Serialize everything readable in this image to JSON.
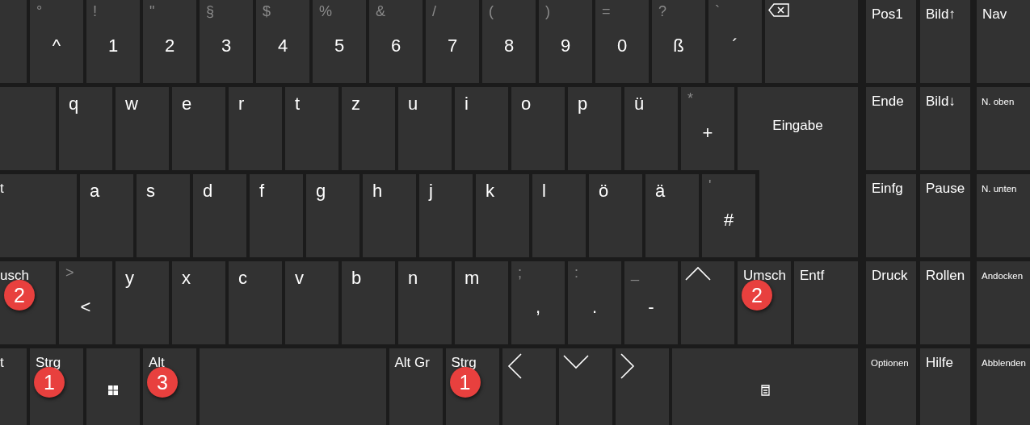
{
  "keyboard": {
    "rows": [
      {
        "keys": [
          {
            "kind": "partial"
          },
          {
            "kind": "dual",
            "shift": "°",
            "label": "^"
          },
          {
            "kind": "dual",
            "shift": "!",
            "label": "1"
          },
          {
            "kind": "dual",
            "shift": "\"",
            "label": "2"
          },
          {
            "kind": "dual",
            "shift": "§",
            "label": "3"
          },
          {
            "kind": "dual",
            "shift": "$",
            "label": "4"
          },
          {
            "kind": "dual",
            "shift": "%",
            "label": "5"
          },
          {
            "kind": "dual",
            "shift": "&",
            "label": "6"
          },
          {
            "kind": "dual",
            "shift": "/",
            "label": "7"
          },
          {
            "kind": "dual",
            "shift": "(",
            "label": "8"
          },
          {
            "kind": "dual",
            "shift": ")",
            "label": "9"
          },
          {
            "kind": "dual",
            "shift": "=",
            "label": "0"
          },
          {
            "kind": "dual",
            "shift": "?",
            "label": "ß"
          },
          {
            "kind": "dual",
            "shift": "`",
            "label": "´"
          },
          {
            "kind": "backspace"
          }
        ]
      },
      {
        "keys": [
          {
            "kind": "partial"
          },
          {
            "kind": "letter",
            "label": "q"
          },
          {
            "kind": "letter",
            "label": "w"
          },
          {
            "kind": "letter",
            "label": "e"
          },
          {
            "kind": "letter",
            "label": "r"
          },
          {
            "kind": "letter",
            "label": "t"
          },
          {
            "kind": "letter",
            "label": "z"
          },
          {
            "kind": "letter",
            "label": "u"
          },
          {
            "kind": "letter",
            "label": "i"
          },
          {
            "kind": "letter",
            "label": "o"
          },
          {
            "kind": "letter",
            "label": "p"
          },
          {
            "kind": "letter",
            "label": "ü"
          },
          {
            "kind": "dual",
            "shift": "*",
            "label": "+"
          },
          {
            "kind": "enter",
            "label": "Eingabe"
          }
        ]
      },
      {
        "keys": [
          {
            "kind": "partial",
            "label": "t"
          },
          {
            "kind": "letter",
            "label": "a"
          },
          {
            "kind": "letter",
            "label": "s"
          },
          {
            "kind": "letter",
            "label": "d"
          },
          {
            "kind": "letter",
            "label": "f"
          },
          {
            "kind": "letter",
            "label": "g"
          },
          {
            "kind": "letter",
            "label": "h"
          },
          {
            "kind": "letter",
            "label": "j"
          },
          {
            "kind": "letter",
            "label": "k"
          },
          {
            "kind": "letter",
            "label": "l"
          },
          {
            "kind": "letter",
            "label": "ö"
          },
          {
            "kind": "letter",
            "label": "ä"
          },
          {
            "kind": "dual",
            "shift": "'",
            "label": "#"
          }
        ]
      },
      {
        "keys": [
          {
            "kind": "partial",
            "label": "usch",
            "badge": "2"
          },
          {
            "kind": "dual",
            "shift": ">",
            "label": "<"
          },
          {
            "kind": "letter",
            "label": "y"
          },
          {
            "kind": "letter",
            "label": "x"
          },
          {
            "kind": "letter",
            "label": "c"
          },
          {
            "kind": "letter",
            "label": "v"
          },
          {
            "kind": "letter",
            "label": "b"
          },
          {
            "kind": "letter",
            "label": "n"
          },
          {
            "kind": "letter",
            "label": "m"
          },
          {
            "kind": "dual",
            "shift": ";",
            "label": ","
          },
          {
            "kind": "dual",
            "shift": ":",
            "label": "."
          },
          {
            "kind": "dual",
            "shift": "_",
            "label": "-"
          },
          {
            "kind": "arrow-up"
          },
          {
            "kind": "mod",
            "label": "Umsch",
            "badge": "2"
          },
          {
            "kind": "mod",
            "label": "Entf"
          }
        ]
      },
      {
        "keys": [
          {
            "kind": "partial",
            "label": "t"
          },
          {
            "kind": "mod",
            "label": "Strg",
            "badge": "1"
          },
          {
            "kind": "windows"
          },
          {
            "kind": "mod",
            "label": "Alt",
            "badge": "3"
          },
          {
            "kind": "space"
          },
          {
            "kind": "mod",
            "label": "Alt Gr"
          },
          {
            "kind": "mod",
            "label": "Strg",
            "badge": "1"
          },
          {
            "kind": "arrow-left"
          },
          {
            "kind": "arrow-down"
          },
          {
            "kind": "arrow-right"
          },
          {
            "kind": "menu"
          }
        ]
      }
    ]
  },
  "nav_keys": [
    {
      "kind": "mod",
      "label": "Pos1"
    },
    {
      "kind": "mod",
      "label": "Bild↑"
    },
    {
      "kind": "mod",
      "label": "Nav"
    },
    {
      "kind": "mod",
      "label": "Ende"
    },
    {
      "kind": "mod",
      "label": "Bild↓"
    },
    {
      "kind": "small",
      "label": "N. oben"
    },
    {
      "kind": "mod",
      "label": "Einfg"
    },
    {
      "kind": "mod",
      "label": "Pause"
    },
    {
      "kind": "small",
      "label": "N. unten"
    },
    {
      "kind": "mod",
      "label": "Druck"
    },
    {
      "kind": "mod",
      "label": "Rollen"
    },
    {
      "kind": "small",
      "label": "Andocken"
    },
    {
      "kind": "small",
      "label": "Optionen"
    },
    {
      "kind": "mod",
      "label": "Hilfe"
    },
    {
      "kind": "small",
      "label": "Abblenden"
    }
  ]
}
